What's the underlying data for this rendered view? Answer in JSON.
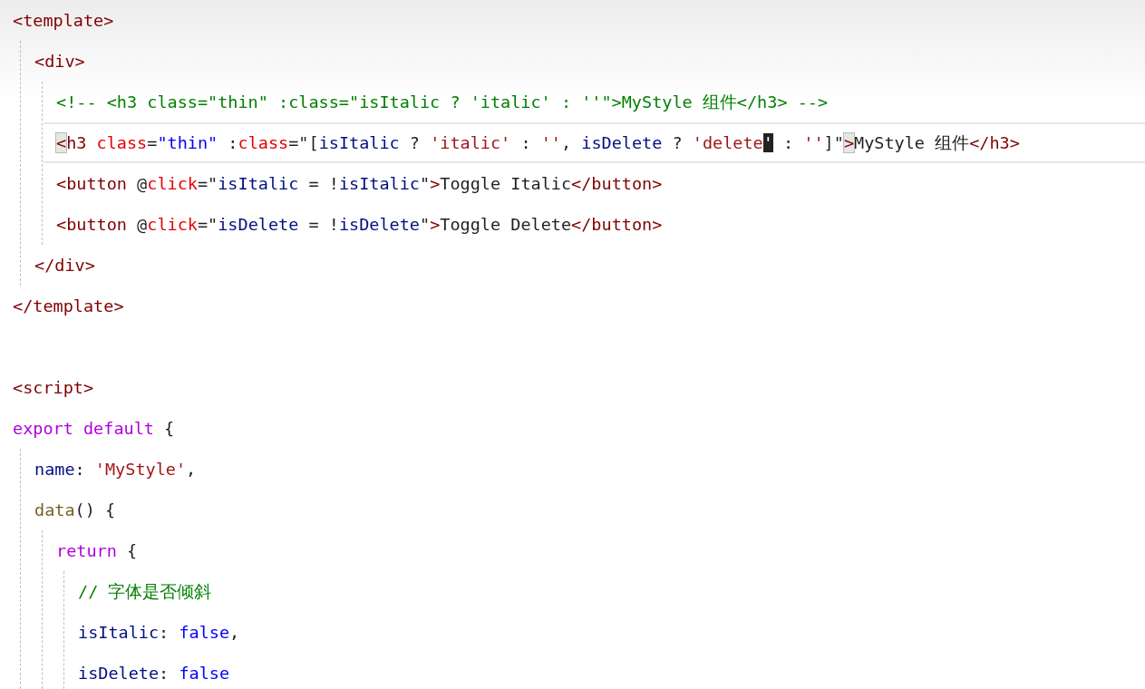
{
  "sections": [
    {
      "lines": [
        {
          "current": false,
          "tokens": [
            {
              "kind": "tag",
              "text": "<template>"
            }
          ],
          "children": [
            {
              "current": false,
              "tokens": [
                {
                  "kind": "tag",
                  "text": "<div>"
                }
              ],
              "children": [
                {
                  "current": false,
                  "tokens": [
                    {
                      "kind": "comment",
                      "text": "<!-- <h3 class=\"thin\" :class=\"isItalic ? 'italic' : ''\">MyStyle 组件</h3> -->"
                    }
                  ]
                },
                {
                  "current": true,
                  "tokens": [
                    {
                      "kind": "match",
                      "text": "<"
                    },
                    {
                      "kind": "tag",
                      "text": "h3"
                    },
                    {
                      "kind": "attr",
                      "text": " class"
                    },
                    {
                      "kind": "text",
                      "text": "="
                    },
                    {
                      "kind": "value",
                      "text": "\"thin\""
                    },
                    {
                      "kind": "text",
                      "text": " :"
                    },
                    {
                      "kind": "attr",
                      "text": "class"
                    },
                    {
                      "kind": "text",
                      "text": "=\"["
                    },
                    {
                      "kind": "ident",
                      "text": "isItalic"
                    },
                    {
                      "kind": "text",
                      "text": " ? "
                    },
                    {
                      "kind": "string",
                      "text": "'italic'"
                    },
                    {
                      "kind": "text",
                      "text": " : "
                    },
                    {
                      "kind": "string",
                      "text": "''"
                    },
                    {
                      "kind": "text",
                      "text": ", "
                    },
                    {
                      "kind": "ident",
                      "text": "isDelete"
                    },
                    {
                      "kind": "text",
                      "text": " ? "
                    },
                    {
                      "kind": "string",
                      "text": "'delete"
                    },
                    {
                      "kind": "cursor",
                      "text": "'"
                    },
                    {
                      "kind": "text",
                      "text": " : "
                    },
                    {
                      "kind": "string",
                      "text": "''"
                    },
                    {
                      "kind": "text",
                      "text": "]\""
                    },
                    {
                      "kind": "match",
                      "text": ">"
                    },
                    {
                      "kind": "text",
                      "text": "MyStyle 组件"
                    },
                    {
                      "kind": "tag",
                      "text": "</h3>"
                    }
                  ]
                },
                {
                  "current": false,
                  "tokens": [
                    {
                      "kind": "tag",
                      "text": "<button"
                    },
                    {
                      "kind": "text",
                      "text": " @"
                    },
                    {
                      "kind": "attr",
                      "text": "click"
                    },
                    {
                      "kind": "text",
                      "text": "=\""
                    },
                    {
                      "kind": "ident",
                      "text": "isItalic"
                    },
                    {
                      "kind": "text",
                      "text": " = !"
                    },
                    {
                      "kind": "ident",
                      "text": "isItalic"
                    },
                    {
                      "kind": "text",
                      "text": "\""
                    },
                    {
                      "kind": "tag",
                      "text": ">"
                    },
                    {
                      "kind": "text",
                      "text": "Toggle Italic"
                    },
                    {
                      "kind": "tag",
                      "text": "</button>"
                    }
                  ]
                },
                {
                  "current": false,
                  "tokens": [
                    {
                      "kind": "tag",
                      "text": "<button"
                    },
                    {
                      "kind": "text",
                      "text": " @"
                    },
                    {
                      "kind": "attr",
                      "text": "click"
                    },
                    {
                      "kind": "text",
                      "text": "=\""
                    },
                    {
                      "kind": "ident",
                      "text": "isDelete"
                    },
                    {
                      "kind": "text",
                      "text": " = !"
                    },
                    {
                      "kind": "ident",
                      "text": "isDelete"
                    },
                    {
                      "kind": "text",
                      "text": "\""
                    },
                    {
                      "kind": "tag",
                      "text": ">"
                    },
                    {
                      "kind": "text",
                      "text": "Toggle Delete"
                    },
                    {
                      "kind": "tag",
                      "text": "</button>"
                    }
                  ]
                }
              ]
            },
            {
              "current": false,
              "tokens": [
                {
                  "kind": "tag",
                  "text": "</div>"
                }
              ]
            }
          ]
        },
        {
          "current": false,
          "tokens": [
            {
              "kind": "tag",
              "text": "</template>"
            }
          ]
        }
      ]
    },
    {
      "lines": [
        {
          "current": false,
          "tokens": [
            {
              "kind": "tag",
              "text": "<script>"
            }
          ]
        },
        {
          "current": false,
          "tokens": [
            {
              "kind": "keyword",
              "text": "export default"
            },
            {
              "kind": "text",
              "text": " {"
            }
          ],
          "children": [
            {
              "current": false,
              "tokens": [
                {
                  "kind": "ident",
                  "text": "name"
                },
                {
                  "kind": "text",
                  "text": ": "
                },
                {
                  "kind": "string",
                  "text": "'MyStyle'"
                },
                {
                  "kind": "text",
                  "text": ","
                }
              ]
            },
            {
              "current": false,
              "tokens": [
                {
                  "kind": "fn",
                  "text": "data"
                },
                {
                  "kind": "text",
                  "text": "() {"
                }
              ],
              "children": [
                {
                  "current": false,
                  "tokens": [
                    {
                      "kind": "keyword",
                      "text": "return"
                    },
                    {
                      "kind": "text",
                      "text": " {"
                    }
                  ],
                  "children": [
                    {
                      "current": false,
                      "tokens": [
                        {
                          "kind": "comment",
                          "text": "// 字体是否倾斜"
                        }
                      ]
                    },
                    {
                      "current": false,
                      "tokens": [
                        {
                          "kind": "ident",
                          "text": "isItalic"
                        },
                        {
                          "kind": "text",
                          "text": ": "
                        },
                        {
                          "kind": "bool",
                          "text": "false"
                        },
                        {
                          "kind": "text",
                          "text": ","
                        }
                      ]
                    },
                    {
                      "current": false,
                      "tokens": [
                        {
                          "kind": "ident",
                          "text": "isDelete"
                        },
                        {
                          "kind": "text",
                          "text": ": "
                        },
                        {
                          "kind": "bool",
                          "text": "false"
                        }
                      ]
                    }
                  ]
                }
              ]
            }
          ]
        }
      ]
    }
  ]
}
